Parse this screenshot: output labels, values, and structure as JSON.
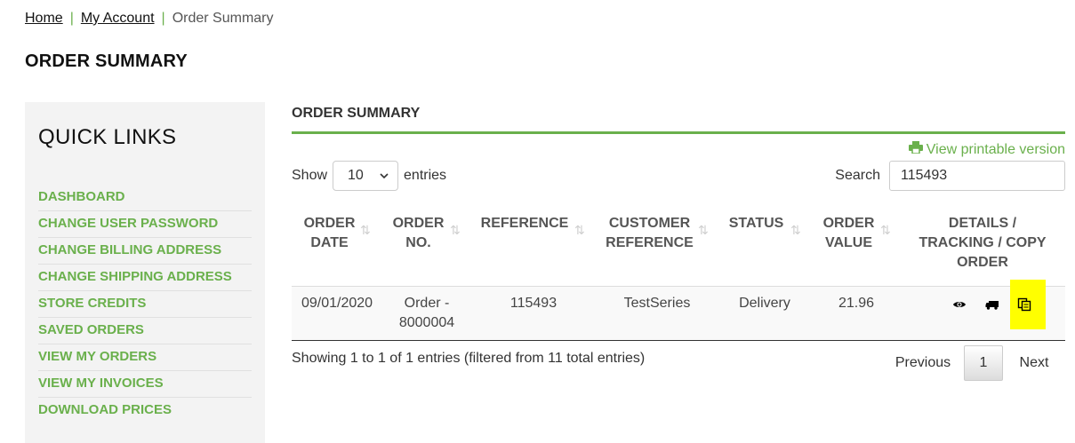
{
  "breadcrumb": {
    "home": "Home",
    "account": "My Account",
    "current": "Order Summary",
    "separator": "|"
  },
  "page_title": "ORDER SUMMARY",
  "sidebar": {
    "title": "QUICK LINKS",
    "items": [
      "DASHBOARD",
      "CHANGE USER PASSWORD",
      "CHANGE BILLING ADDRESS",
      "CHANGE SHIPPING ADDRESS",
      "STORE CREDITS",
      "SAVED ORDERS",
      "VIEW MY ORDERS",
      "VIEW MY INVOICES",
      "DOWNLOAD PRICES"
    ]
  },
  "main": {
    "heading": "ORDER SUMMARY",
    "print_link": "View printable version",
    "show_label": "Show",
    "entries_value": "10",
    "entries_label": "entries",
    "search_label": "Search",
    "search_value": "115493"
  },
  "table": {
    "headers": {
      "order_date": [
        "ORDER",
        "DATE"
      ],
      "order_no": [
        "ORDER",
        "NO."
      ],
      "reference": [
        "REFERENCE"
      ],
      "customer_reference": [
        "CUSTOMER",
        "REFERENCE"
      ],
      "status": [
        "STATUS"
      ],
      "order_value": [
        "ORDER",
        "VALUE"
      ],
      "details": [
        "DETAILS /",
        "TRACKING / COPY",
        "ORDER"
      ]
    },
    "rows": [
      {
        "order_date": "09/01/2020",
        "order_no": [
          "Order -",
          "8000004"
        ],
        "reference": "115493",
        "customer_reference": "TestSeries",
        "status": "Delivery",
        "order_value": "21.96"
      }
    ]
  },
  "footer": {
    "info": "Showing 1 to 1 of 1 entries (filtered from 11 total entries)",
    "previous": "Previous",
    "page": "1",
    "next": "Next"
  },
  "colors": {
    "accent": "#6ab04c",
    "highlight": "#ffff00"
  },
  "icons": {
    "print": "print-icon",
    "view": "eye-icon",
    "tracking": "truck-icon",
    "copy": "copy-icon",
    "sort": "sort-icon",
    "dropdown": "chevron-down-icon"
  }
}
